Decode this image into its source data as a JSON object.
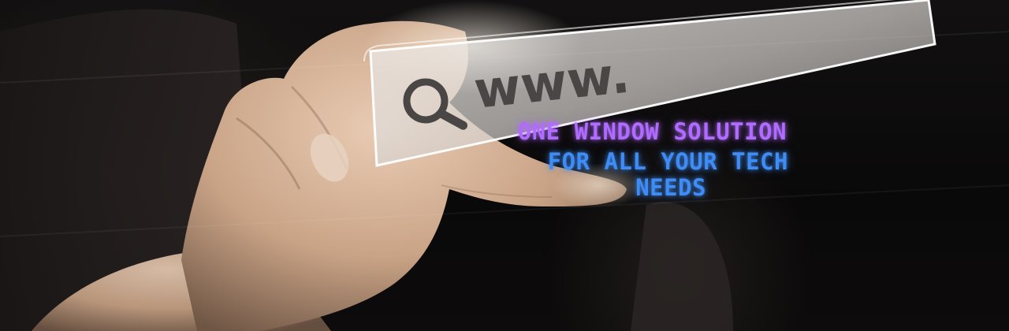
{
  "search_bar": {
    "url_prefix": "www.",
    "icon": "search-icon"
  },
  "tagline": {
    "line1": "ONE WINDOW SOLUTION",
    "line2": "FOR ALL YOUR TECH",
    "line3": "NEEDS"
  },
  "colors": {
    "tagline_purple": "#b06bff",
    "tagline_blue": "#3f8cf5",
    "background": "#0b0a0a",
    "bar_glass": "#d9d5d2"
  }
}
